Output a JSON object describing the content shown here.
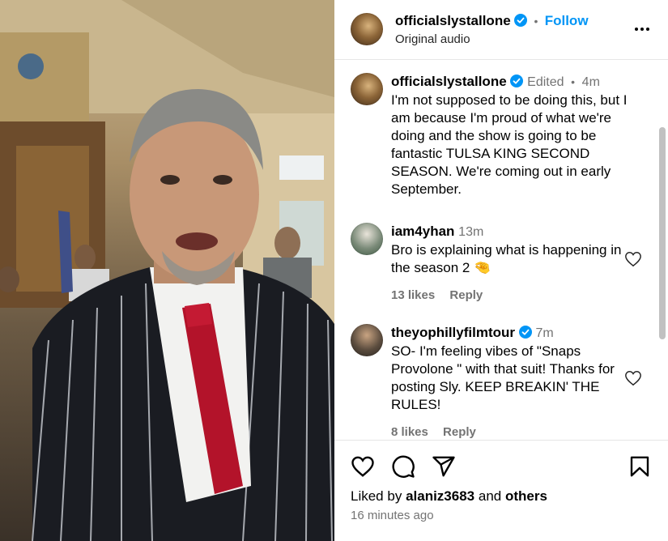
{
  "post": {
    "author": "officialslystallone",
    "follow_label": "Follow",
    "audio": "Original audio"
  },
  "caption": {
    "author": "officialslystallone",
    "edited": "Edited",
    "time": "4m",
    "text": "I'm not supposed to be doing this, but I am because I'm proud of what we're doing and the show is going to be fantastic TULSA KING SECOND SEASON. We're coming out in early September."
  },
  "comments": [
    {
      "author": "iam4yhan",
      "time": "13m",
      "text": "Bro is explaining what is happening in the season 2 🤏",
      "likes": "13 likes",
      "reply": "Reply"
    },
    {
      "author": "theyophillyfilmtour",
      "time": "7m",
      "text": "SO- I'm feeling vibes of \"Snaps Provolone \" with that suit! Thanks for posting Sly. KEEP BREAKIN' THE RULES!",
      "likes": "8 likes",
      "reply": "Reply"
    }
  ],
  "footer": {
    "liked_prefix": "Liked by",
    "liked_user": "alaniz3683",
    "liked_and": "and",
    "liked_others": "others",
    "time_ago": "16 minutes ago"
  },
  "icons": {
    "verified": "verified-badge-icon",
    "more": "more-options-icon",
    "like": "heart-icon",
    "comment": "comment-icon",
    "share": "share-icon",
    "save": "bookmark-icon"
  },
  "colors": {
    "accent": "#0095f6",
    "muted": "#737373"
  }
}
